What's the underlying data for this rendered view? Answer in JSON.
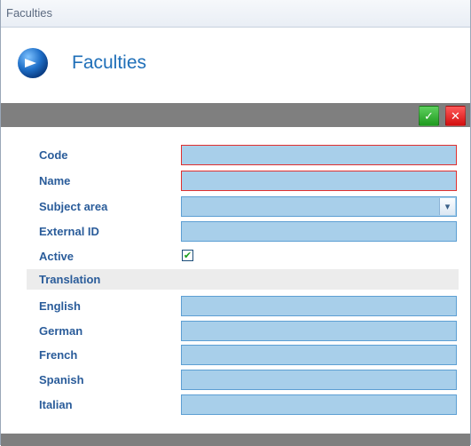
{
  "window": {
    "title": "Faculties"
  },
  "header": {
    "title": "Faculties",
    "icon": "arrow-orb-icon",
    "accent": "#1f6fb8"
  },
  "toolbar": {
    "save_icon": "save-check-icon",
    "save_glyph": "✓",
    "close_icon": "close-x-icon",
    "close_glyph": "✕"
  },
  "form": {
    "code": {
      "label": "Code",
      "value": ""
    },
    "name": {
      "label": "Name",
      "value": ""
    },
    "subject_area": {
      "label": "Subject area",
      "value": "",
      "arrow": "▾"
    },
    "external_id": {
      "label": "External ID",
      "value": ""
    },
    "active": {
      "label": "Active",
      "checked": true,
      "glyph": "✔"
    },
    "translation_section": {
      "label": "Translation"
    },
    "translations": {
      "english": {
        "label": "English",
        "value": ""
      },
      "german": {
        "label": "German",
        "value": ""
      },
      "french": {
        "label": "French",
        "value": ""
      },
      "spanish": {
        "label": "Spanish",
        "value": ""
      },
      "italian": {
        "label": "Italian",
        "value": ""
      }
    }
  },
  "colors": {
    "field_bg": "#a8cfea",
    "field_border": "#5d9fd3",
    "required_border": "#e0302f",
    "label": "#2a5c9a",
    "toolbar": "#7f7f7f"
  }
}
